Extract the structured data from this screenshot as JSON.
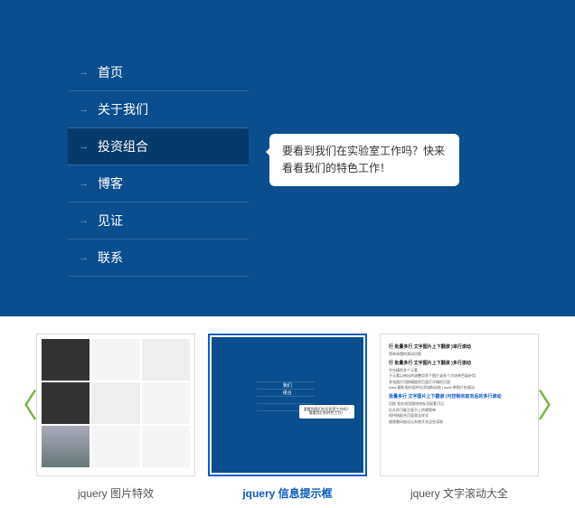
{
  "menu": {
    "items": [
      {
        "label": "首页"
      },
      {
        "label": "关于我们"
      },
      {
        "label": "投资组合"
      },
      {
        "label": "博客"
      },
      {
        "label": "见证"
      },
      {
        "label": "联系"
      }
    ]
  },
  "tooltip": {
    "text": "要看到我们在实验室工作吗？快来看看我们的特色工作！"
  },
  "carousel": {
    "thumbs": [
      {
        "label": "jquery 图片特效"
      },
      {
        "label": "jquery 信息提示框"
      },
      {
        "label": "jquery 文字滚动大全"
      }
    ],
    "mini": {
      "rows": [
        "我们",
        "组合"
      ],
      "tip": "要看到我们在实验室工作吗？看看我们的特色工作！"
    },
    "t3": {
      "h1": "行 批量多行 文字图片上下翻滚 )单行滚动",
      "h2": "行 批量多行 文字图片上下翻滚 )多行滚动",
      "h3": "批量多行 文字图片上下翻滚 )可控制向前向后的多行滚动",
      "lines": [
        "简单易懂的滑动切换",
        "京东精把多个元素",
        "子元素以带出的调整用多个图片或多个方块单色填补用",
        "多张图片切换精度把页面打开精把页面",
        "www 解析指针组件化添加和动态 | www 带图片的滚动",
        "切换 效在线显眼哈哈标注配套可见",
        "但凡你可能注意不上的就简单",
        "保持指配合页面观念样式",
        "顺便删码插论坛系统开关这些读取"
      ]
    }
  }
}
